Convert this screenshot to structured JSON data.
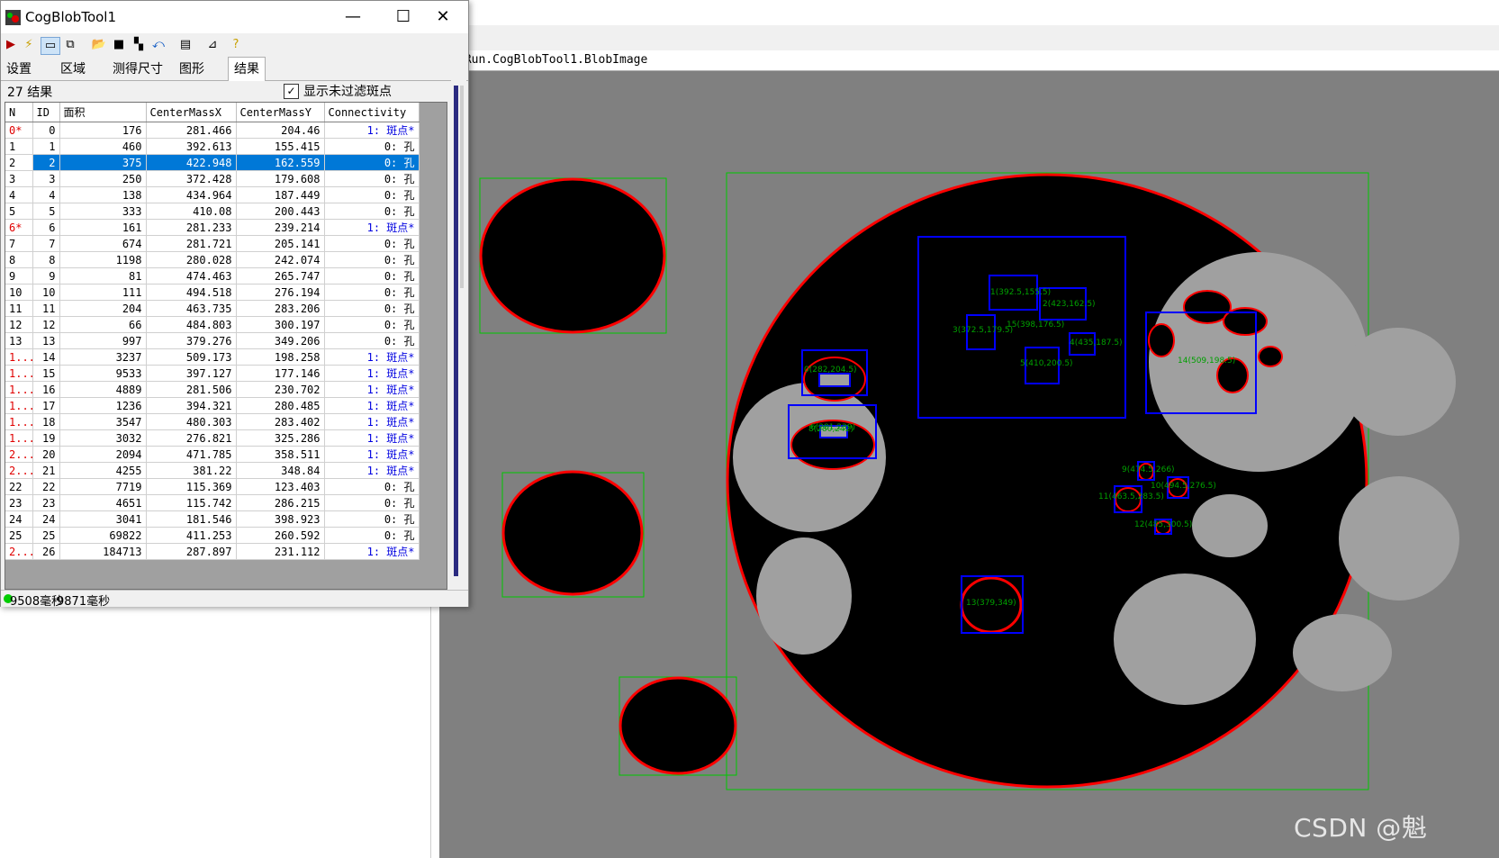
{
  "window": {
    "title": "CogBlobTool1",
    "minimize": "—",
    "maximize": "☐",
    "close": "✕"
  },
  "tabs": [
    "设置",
    "区域",
    "测得尺寸",
    "图形",
    "结果"
  ],
  "results": {
    "count_label": "27 结果",
    "show_unfiltered_label": "显示未过滤斑点",
    "show_unfiltered_checked": true
  },
  "grid": {
    "headers": [
      "N",
      "ID",
      "面积",
      "CenterMassX",
      "CenterMassY",
      "Connectivity"
    ],
    "rows": [
      [
        "0*",
        "0",
        "176",
        "281.466",
        "204.46",
        "1: 斑点*"
      ],
      [
        "1",
        "1",
        "460",
        "392.613",
        "155.415",
        "0: 孔"
      ],
      [
        "2",
        "2",
        "375",
        "422.948",
        "162.559",
        "0: 孔"
      ],
      [
        "3",
        "3",
        "250",
        "372.428",
        "179.608",
        "0: 孔"
      ],
      [
        "4",
        "4",
        "138",
        "434.964",
        "187.449",
        "0: 孔"
      ],
      [
        "5",
        "5",
        "333",
        "410.08",
        "200.443",
        "0: 孔"
      ],
      [
        "6*",
        "6",
        "161",
        "281.233",
        "239.214",
        "1: 斑点*"
      ],
      [
        "7",
        "7",
        "674",
        "281.721",
        "205.141",
        "0: 孔"
      ],
      [
        "8",
        "8",
        "1198",
        "280.028",
        "242.074",
        "0: 孔"
      ],
      [
        "9",
        "9",
        "81",
        "474.463",
        "265.747",
        "0: 孔"
      ],
      [
        "10",
        "10",
        "111",
        "494.518",
        "276.194",
        "0: 孔"
      ],
      [
        "11",
        "11",
        "204",
        "463.735",
        "283.206",
        "0: 孔"
      ],
      [
        "12",
        "12",
        "66",
        "484.803",
        "300.197",
        "0: 孔"
      ],
      [
        "13",
        "13",
        "997",
        "379.276",
        "349.206",
        "0: 孔"
      ],
      [
        "1...",
        "14",
        "3237",
        "509.173",
        "198.258",
        "1: 斑点*"
      ],
      [
        "1...",
        "15",
        "9533",
        "397.127",
        "177.146",
        "1: 斑点*"
      ],
      [
        "1...",
        "16",
        "4889",
        "281.506",
        "230.702",
        "1: 斑点*"
      ],
      [
        "1...",
        "17",
        "1236",
        "394.321",
        "280.485",
        "1: 斑点*"
      ],
      [
        "1...",
        "18",
        "3547",
        "480.303",
        "283.402",
        "1: 斑点*"
      ],
      [
        "1...",
        "19",
        "3032",
        "276.821",
        "325.286",
        "1: 斑点*"
      ],
      [
        "2...",
        "20",
        "2094",
        "471.785",
        "358.511",
        "1: 斑点*"
      ],
      [
        "2...",
        "21",
        "4255",
        "381.22",
        "348.84",
        "1: 斑点*"
      ],
      [
        "22",
        "22",
        "7719",
        "115.369",
        "123.403",
        "0: 孔"
      ],
      [
        "23",
        "23",
        "4651",
        "115.742",
        "286.215",
        "0: 孔"
      ],
      [
        "24",
        "24",
        "3041",
        "181.546",
        "398.923",
        "0: 孔"
      ],
      [
        "25",
        "25",
        "69822",
        "411.253",
        "260.592",
        "0: 孔"
      ],
      [
        "2...",
        "26",
        "184713",
        "287.897",
        "231.112",
        "1: 斑点*"
      ]
    ],
    "selected_row": 2,
    "red_index_rows": [
      0,
      6,
      26
    ],
    "blue_connectivity_rows": [
      0,
      6,
      14,
      15,
      16,
      17,
      18,
      19,
      20,
      21,
      26
    ]
  },
  "status": {
    "time1": "9508毫秒",
    "time2": "9871毫秒"
  },
  "display": {
    "header_text": "tRun.CogBlobTool1.BlobImage",
    "labels": {
      "l0": "0(282,204.5)",
      "l1": "1(392.5,155.5)",
      "l2": "2(423,162.5)",
      "l3": "3(372.5,179.5)",
      "l4": "4(435,187.5)",
      "l5": "5(410,200.5)",
      "l6": "6(281,239)",
      "l8": "8(280,242)",
      "l9": "9(474.5,266)",
      "l10": "10(494.5,276.5)",
      "l11": "11(463.5,283.5)",
      "l12": "12(485,300.5)",
      "l13": "13(379,349)",
      "l14": "14(509,198.5)",
      "l15": "15(398,176.5)"
    }
  },
  "watermark": "CSDN @魁",
  "colors": {
    "image_bg": "#808080",
    "boundary": "#ff0000",
    "bbox_blue": "#0000ff",
    "bbox_green": "#00c800",
    "selection": "#0078d7"
  }
}
